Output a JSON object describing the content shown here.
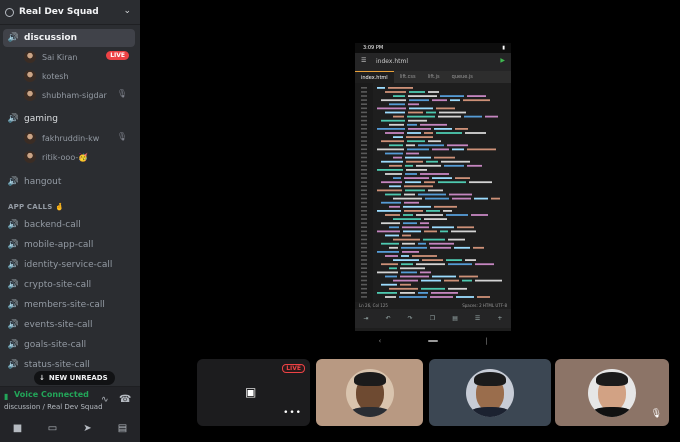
{
  "server": {
    "name": "Real Dev Squad"
  },
  "channels": [
    {
      "name": "discussion"
    },
    {
      "name": "gaming"
    },
    {
      "name": "hangout"
    }
  ],
  "discussion_users": [
    {
      "name": "Sai Kiran",
      "badge": "LIVE"
    },
    {
      "name": "kotesh"
    },
    {
      "name": "shubham-sigdar"
    }
  ],
  "gaming_users": [
    {
      "name": "fakhruddin-kw"
    },
    {
      "name": "ritik-ooo-🥳"
    }
  ],
  "category": {
    "label": "APP CALLS 🤞"
  },
  "app_call_channels": [
    {
      "name": "backend-call"
    },
    {
      "name": "mobile-app-call"
    },
    {
      "name": "identity-service-call"
    },
    {
      "name": "crypto-site-call"
    },
    {
      "name": "members-site-call"
    },
    {
      "name": "events-site-call"
    },
    {
      "name": "goals-site-call"
    },
    {
      "name": "status-site-call"
    }
  ],
  "new_unreads": "NEW UNREADS",
  "voice": {
    "status": "Voice Connected",
    "location": "discussion / Real Dev Squad"
  },
  "stream": {
    "phone_time": "3:09 PM",
    "file_name": "index.html",
    "tabs": [
      "index.html",
      "lift.css",
      "lift.js",
      "queue.js"
    ],
    "status_left": "Ln 26, Col 125",
    "status_right": "Spaces: 2   HTML   UTF-8"
  },
  "tiles": {
    "self_live_badge": "LIVE"
  },
  "colors": {
    "sidebar_bg": "#2b2d31",
    "voice_green": "#23a559",
    "live_red": "#ed4245",
    "stage_bg": "#000000"
  }
}
